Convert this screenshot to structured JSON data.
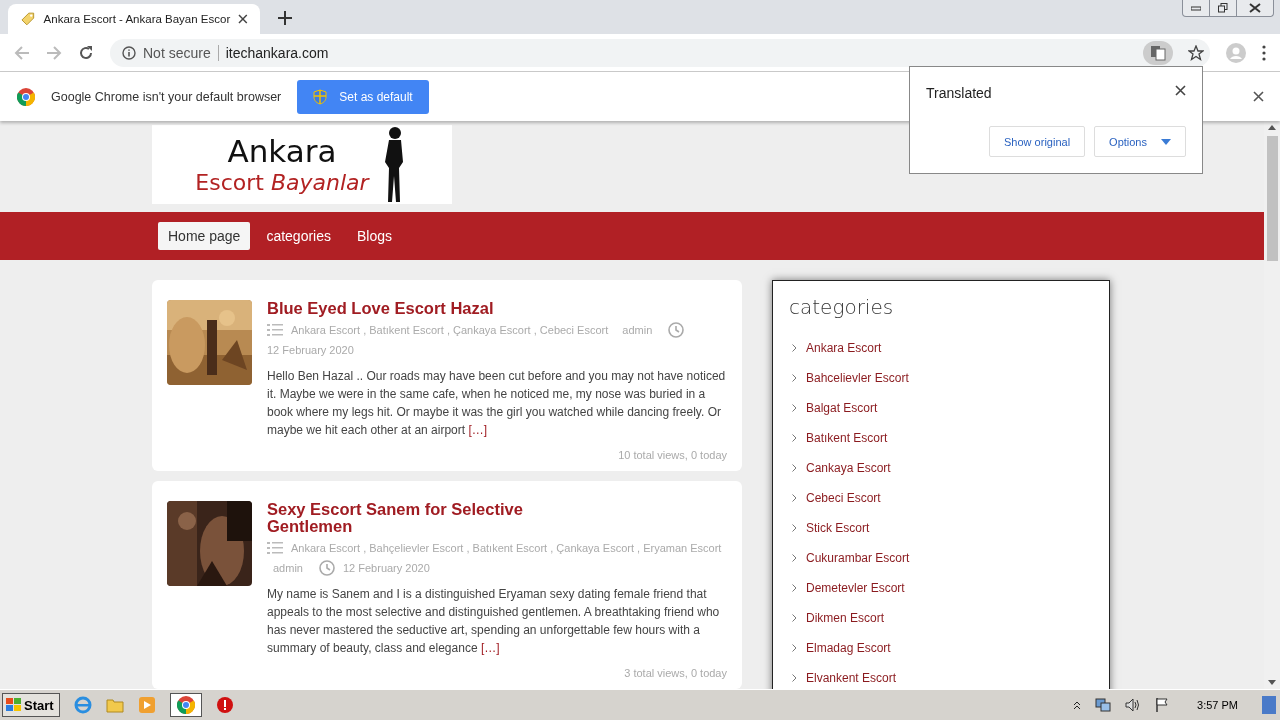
{
  "browser": {
    "tab": {
      "title": "Ankara Escort - Ankara Bayan Escor"
    },
    "address": {
      "security": "Not secure",
      "url": "itechankara.com"
    },
    "infobar": {
      "message": "Google Chrome isn't your default browser",
      "button": "Set as default"
    },
    "translate_popup": {
      "title": "Translated",
      "buttons": [
        "Show original",
        "Options"
      ]
    }
  },
  "site": {
    "logo": {
      "line1": "Ankara",
      "line2": "Escort",
      "line2_italic": "Bayanlar"
    },
    "nav": [
      {
        "label": "Home page",
        "selected": true
      },
      {
        "label": "categories",
        "selected": false
      },
      {
        "label": "Blogs",
        "selected": false
      }
    ],
    "posts": [
      {
        "title": "Blue Eyed Love Escort Hazal",
        "categories": "Ankara Escort , Batıkent Escort , Çankaya Escort , Cebeci Escort",
        "author": "admin",
        "date": "12 February 2020",
        "excerpt": "Hello Ben Hazal .. Our roads may have been cut before and you may not have noticed it. Maybe we were in the same cafe, when he noticed me, my nose was buried in a book where my legs hit. Or maybe it was the girl you watched while dancing freely. Or maybe we hit each other at an airport",
        "more": "[…]",
        "views": "10 total views, 0 today"
      },
      {
        "title": "Sexy Escort Sanem for Selective Gentlemen",
        "categories": "Ankara Escort , Bahçelievler Escort , Batıkent Escort , Çankaya Escort , Eryaman Escort",
        "author": "admin",
        "date": "12 February 2020",
        "excerpt": "My name is Sanem and I is a distinguished Eryaman sexy dating female friend that appeals to the most selective and distinguished gentlemen. A breathtaking friend who has never mastered the seductive art, spending an unforgettable few hours with a summary of beauty, class and elegance",
        "more": "[…]",
        "views": "3 total views, 0 today"
      }
    ],
    "sidebar": {
      "title": "categories",
      "items": [
        "Ankara Escort",
        "Bahcelievler Escort",
        "Balgat Escort",
        "Batıkent Escort",
        "Cankaya Escort",
        "Cebeci Escort",
        "Stick Escort",
        "Cukurambar Escort",
        "Demetevler Escort",
        "Dikmen Escort",
        "Elmadag Escort",
        "Elvankent Escort"
      ]
    }
  },
  "taskbar": {
    "start": "Start",
    "time": "3:57 PM"
  }
}
